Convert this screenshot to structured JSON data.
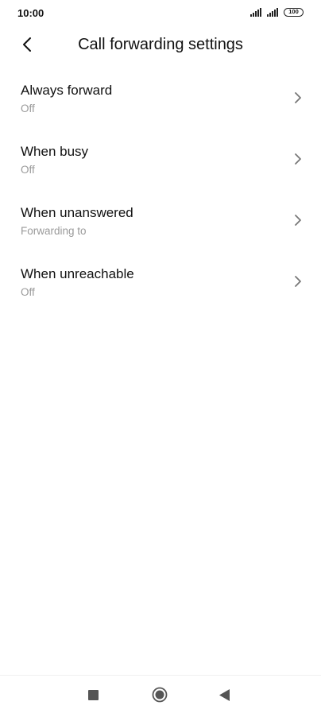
{
  "status_bar": {
    "time": "10:00",
    "battery": "100",
    "icons": [
      "signal-icon",
      "signal-icon",
      "battery-icon"
    ]
  },
  "header": {
    "back_icon": "back-arrow-icon",
    "title": "Call forwarding settings"
  },
  "settings": {
    "items": [
      {
        "title": "Always forward",
        "subtitle": "Off"
      },
      {
        "title": "When busy",
        "subtitle": "Off"
      },
      {
        "title": "When unanswered",
        "subtitle": "Forwarding to"
      },
      {
        "title": "When unreachable",
        "subtitle": "Off"
      }
    ]
  },
  "nav_bar": {
    "icons": [
      "recents-square-icon",
      "home-circle-icon",
      "back-triangle-icon"
    ]
  }
}
